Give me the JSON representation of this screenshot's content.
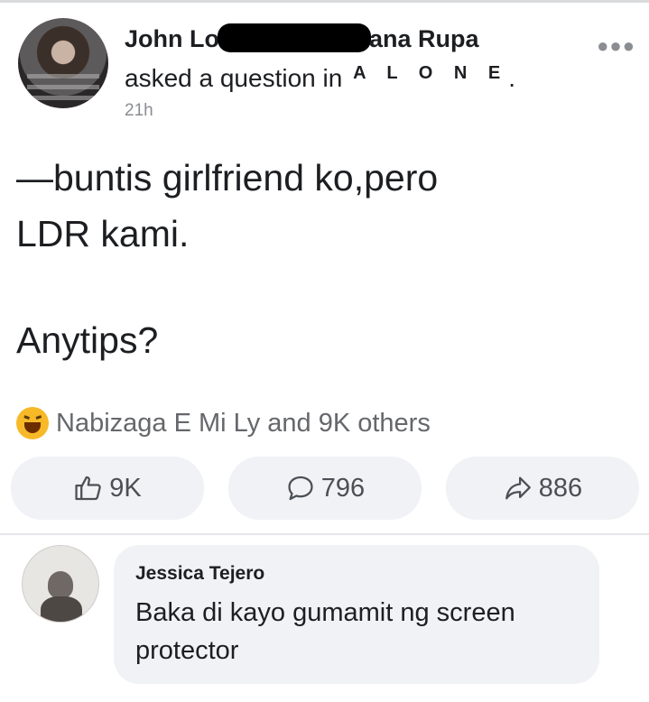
{
  "post": {
    "author_first": "John Lo",
    "author_last": "ana Rupa",
    "asked_prefix": "asked a question in",
    "group_name": "A L O N E",
    "group_suffix": ".",
    "time": "21h",
    "more_icon": "more-dots-icon",
    "body_line1": "—buntis girlfriend ko,pero",
    "body_line2": "LDR kami.",
    "body_line3": "Anytips?"
  },
  "reactions": {
    "icon": "haha-reaction-icon",
    "summary": "Nabizaga E Mi Ly and 9K others"
  },
  "actions": {
    "like_count": "9K",
    "comment_count": "796",
    "share_count": "886"
  },
  "comment": {
    "author": "Jessica Tejero",
    "text": "Baka di kayo gumamit ng screen protector"
  },
  "colors": {
    "bubble_bg": "#f0f2f5",
    "muted_text": "#65676b",
    "primary_text": "#1c1e21"
  }
}
